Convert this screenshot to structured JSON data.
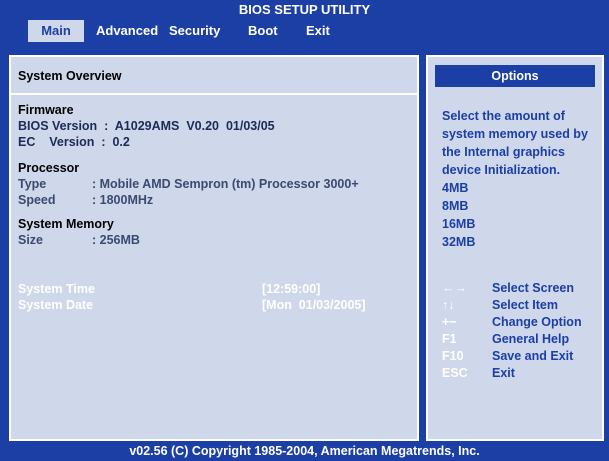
{
  "window": {
    "title": "BIOS SETUP UTILITY"
  },
  "menu": [
    {
      "label": "Main",
      "active": true
    },
    {
      "label": "Advanced",
      "active": false
    },
    {
      "label": "Security",
      "active": false
    },
    {
      "label": "Boot",
      "active": false
    },
    {
      "label": "Exit",
      "active": false
    }
  ],
  "overview": {
    "heading": "System Overview",
    "firmware": {
      "title": "Firmware",
      "bios_line": "BIOS Version  :  A1029AMS  V0.20  01/03/05",
      "ec_line": "EC    Version  :  0.2"
    },
    "processor": {
      "title": "Processor",
      "type_label": "Type",
      "type_value": ": Mobile AMD Sempron (tm) Processor 3000+",
      "speed_label": "Speed",
      "speed_value": ": 1800MHz"
    },
    "memory": {
      "title": "System Memory",
      "size_label": "Size",
      "size_value": ": 256MB"
    },
    "time": {
      "label": "System Time",
      "value": "[12:59:00]"
    },
    "date": {
      "label": "System Date",
      "value": "[Mon  01/03/2005]"
    }
  },
  "options": {
    "header": "Options",
    "help_text": "Select the amount of system memory used by the Internal graphics device Initialization.",
    "choices": [
      "4MB",
      "8MB",
      "16MB",
      "32MB"
    ],
    "keys": [
      {
        "key": "←→",
        "desc": "Select Screen"
      },
      {
        "key": "↑↓",
        "desc": "Select Item"
      },
      {
        "key": "+−",
        "desc": "Change Option"
      },
      {
        "key": "F1",
        "desc": "General Help"
      },
      {
        "key": "F10",
        "desc": "Save and Exit"
      },
      {
        "key": "ESC",
        "desc": "Exit"
      }
    ]
  },
  "footer": {
    "copyright": "v02.56 (C) Copyright  1985-2004, American Megatrends, Inc."
  },
  "colors": {
    "background": "#1c3fa6",
    "panel": "#cfd7ea",
    "highlight": "#ffffff"
  }
}
